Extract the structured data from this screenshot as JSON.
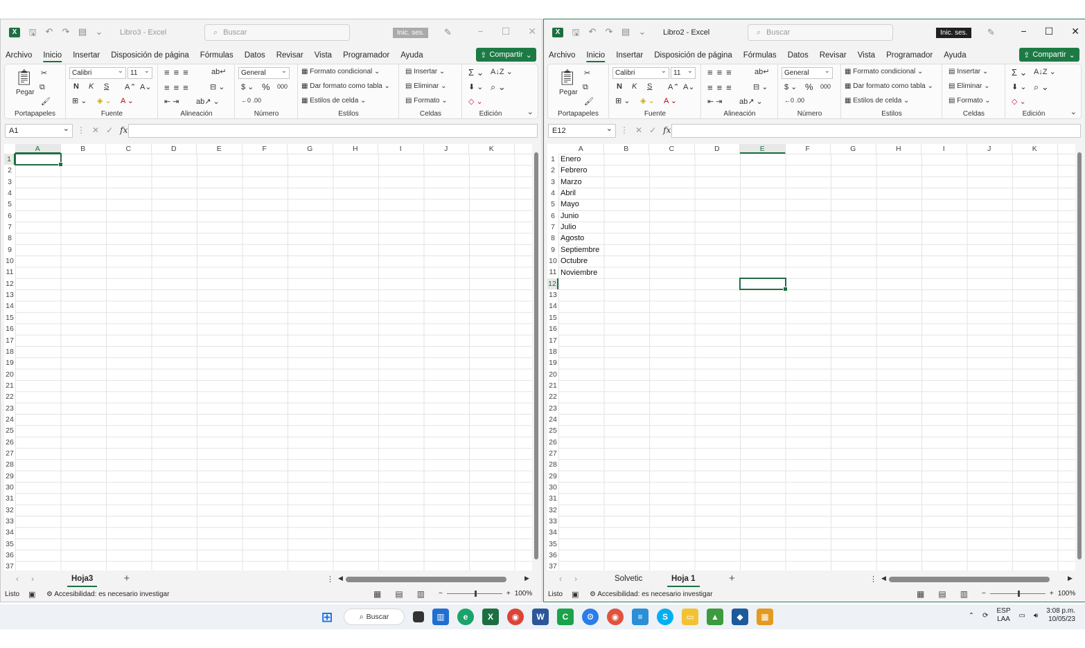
{
  "windows": [
    {
      "title": "Libro3 - Excel",
      "search_placeholder": "Buscar",
      "signin": "Inic. ses.",
      "share": "Compartir",
      "tabs": [
        "Archivo",
        "Inicio",
        "Insertar",
        "Disposición de página",
        "Fórmulas",
        "Datos",
        "Revisar",
        "Vista",
        "Programador",
        "Ayuda"
      ],
      "name_box": "A1",
      "selected_cell": "A1",
      "cells": [],
      "sheets": [
        "Hoja3"
      ],
      "active_sheet": "Hoja3"
    },
    {
      "title": "Libro2 - Excel",
      "search_placeholder": "Buscar",
      "signin": "Inic. ses.",
      "share": "Compartir",
      "tabs": [
        "Archivo",
        "Inicio",
        "Insertar",
        "Disposición de página",
        "Fórmulas",
        "Datos",
        "Revisar",
        "Vista",
        "Programador",
        "Ayuda"
      ],
      "name_box": "E12",
      "selected_cell": "E12",
      "cells": [
        "Enero",
        "Febrero",
        "Marzo",
        "Abril",
        "Mayo",
        "Junio",
        "Julio",
        "Agosto",
        "Septiembre",
        "Octubre",
        "Noviembre"
      ],
      "sheets": [
        "Solvetic",
        "Hoja 1"
      ],
      "active_sheet": "Hoja 1"
    }
  ],
  "ribbon": {
    "paste": "Pegar",
    "font_name": "Calibri",
    "font_size": "11",
    "bold": "N",
    "italic": "K",
    "underline": "S",
    "number_format": "General",
    "cond_format": "Formato condicional",
    "format_table": "Dar formato como tabla",
    "cell_styles": "Estilos de celda",
    "insert": "Insertar",
    "delete": "Eliminar",
    "format": "Formato",
    "groups": [
      "Portapapeles",
      "Fuente",
      "Alineación",
      "Número",
      "Estilos",
      "Celdas",
      "Edición"
    ]
  },
  "columns": [
    "A",
    "B",
    "C",
    "D",
    "E",
    "F",
    "G",
    "H",
    "I",
    "J",
    "K"
  ],
  "row_count": 37,
  "status": {
    "ready": "Listo",
    "accessibility": "Accesibilidad: es necesario investigar",
    "zoom": "100%"
  },
  "taskbar": {
    "search": "Buscar",
    "lang_top": "ESP",
    "lang_bottom": "LAA",
    "time": "3:08 p.m.",
    "date": "10/05/23"
  },
  "colors": {
    "excel_green": "#1d6f42",
    "share_green": "#1d7a45"
  }
}
